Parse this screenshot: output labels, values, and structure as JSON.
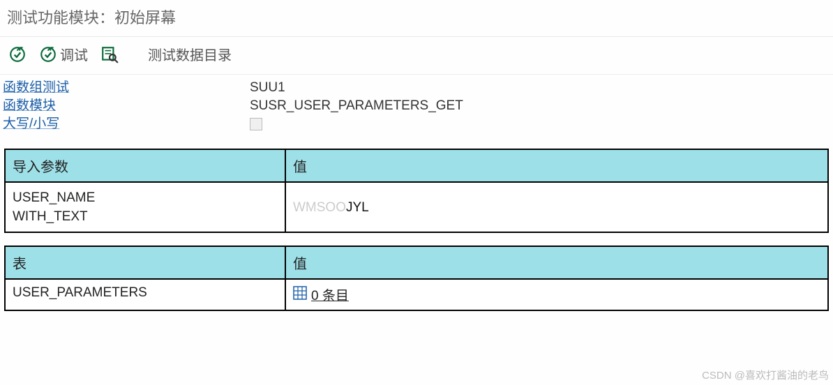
{
  "title": "测试功能模块：初始屏幕",
  "toolbar": {
    "debug_label": "调试",
    "directory_label": "测试数据目录"
  },
  "info": {
    "func_group_label": "函数组测试",
    "func_group_value": "SUU1",
    "func_module_label": "函数模块",
    "func_module_value": "SUSR_USER_PARAMETERS_GET",
    "case_label": "大写/小写"
  },
  "import_section": {
    "header_left": "导入参数",
    "header_right": "值",
    "params": [
      "USER_NAME",
      "WITH_TEXT"
    ],
    "value_faded": "WMSOO",
    "value_solid": "JYL"
  },
  "table_section": {
    "header_left": "表",
    "header_right": "值",
    "param": "USER_PARAMETERS",
    "entry_text": "0 条目"
  },
  "watermark": "CSDN @喜欢打酱油的老鸟"
}
